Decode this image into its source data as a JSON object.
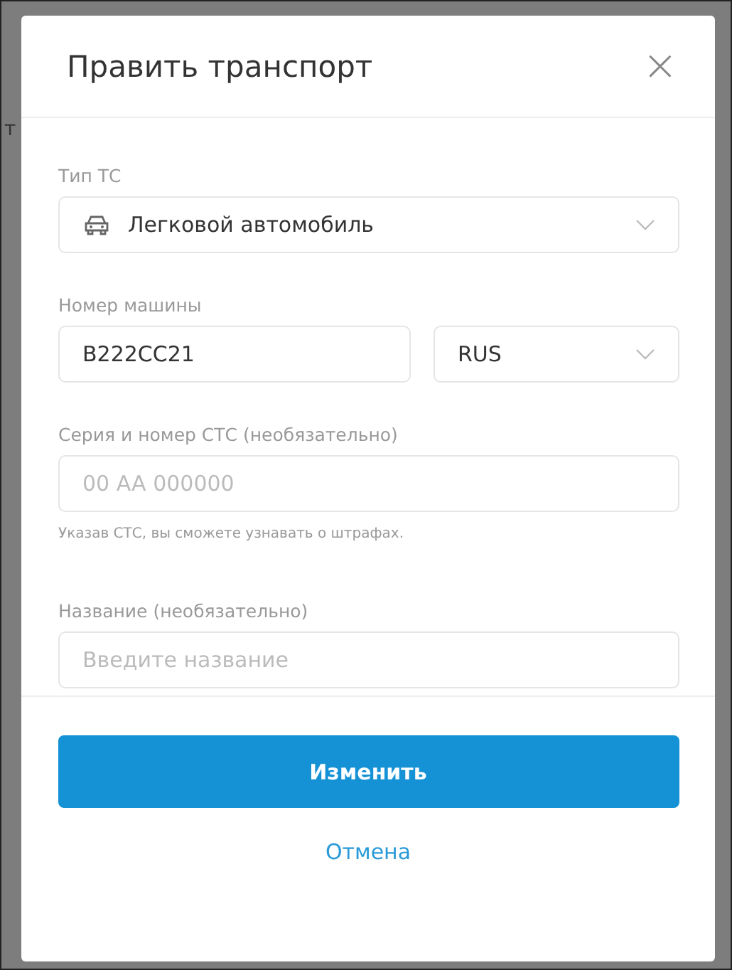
{
  "background_text": "т",
  "dialog": {
    "title": "Править транспорт",
    "close": "×"
  },
  "vehicle_type": {
    "label": "Тип ТС",
    "value": "Легковой автомобиль"
  },
  "plate": {
    "label": "Номер машины",
    "value": "B222CC21",
    "region": "RUS"
  },
  "sts": {
    "label": "Серия и номер СТС (необязательно)",
    "placeholder": "00 AA 000000",
    "hint": "Указав СТС, вы сможете узнавать о штрафах."
  },
  "name": {
    "label": "Название (необязательно)",
    "placeholder": "Введите название"
  },
  "buttons": {
    "submit": "Изменить",
    "cancel": "Отмена"
  }
}
